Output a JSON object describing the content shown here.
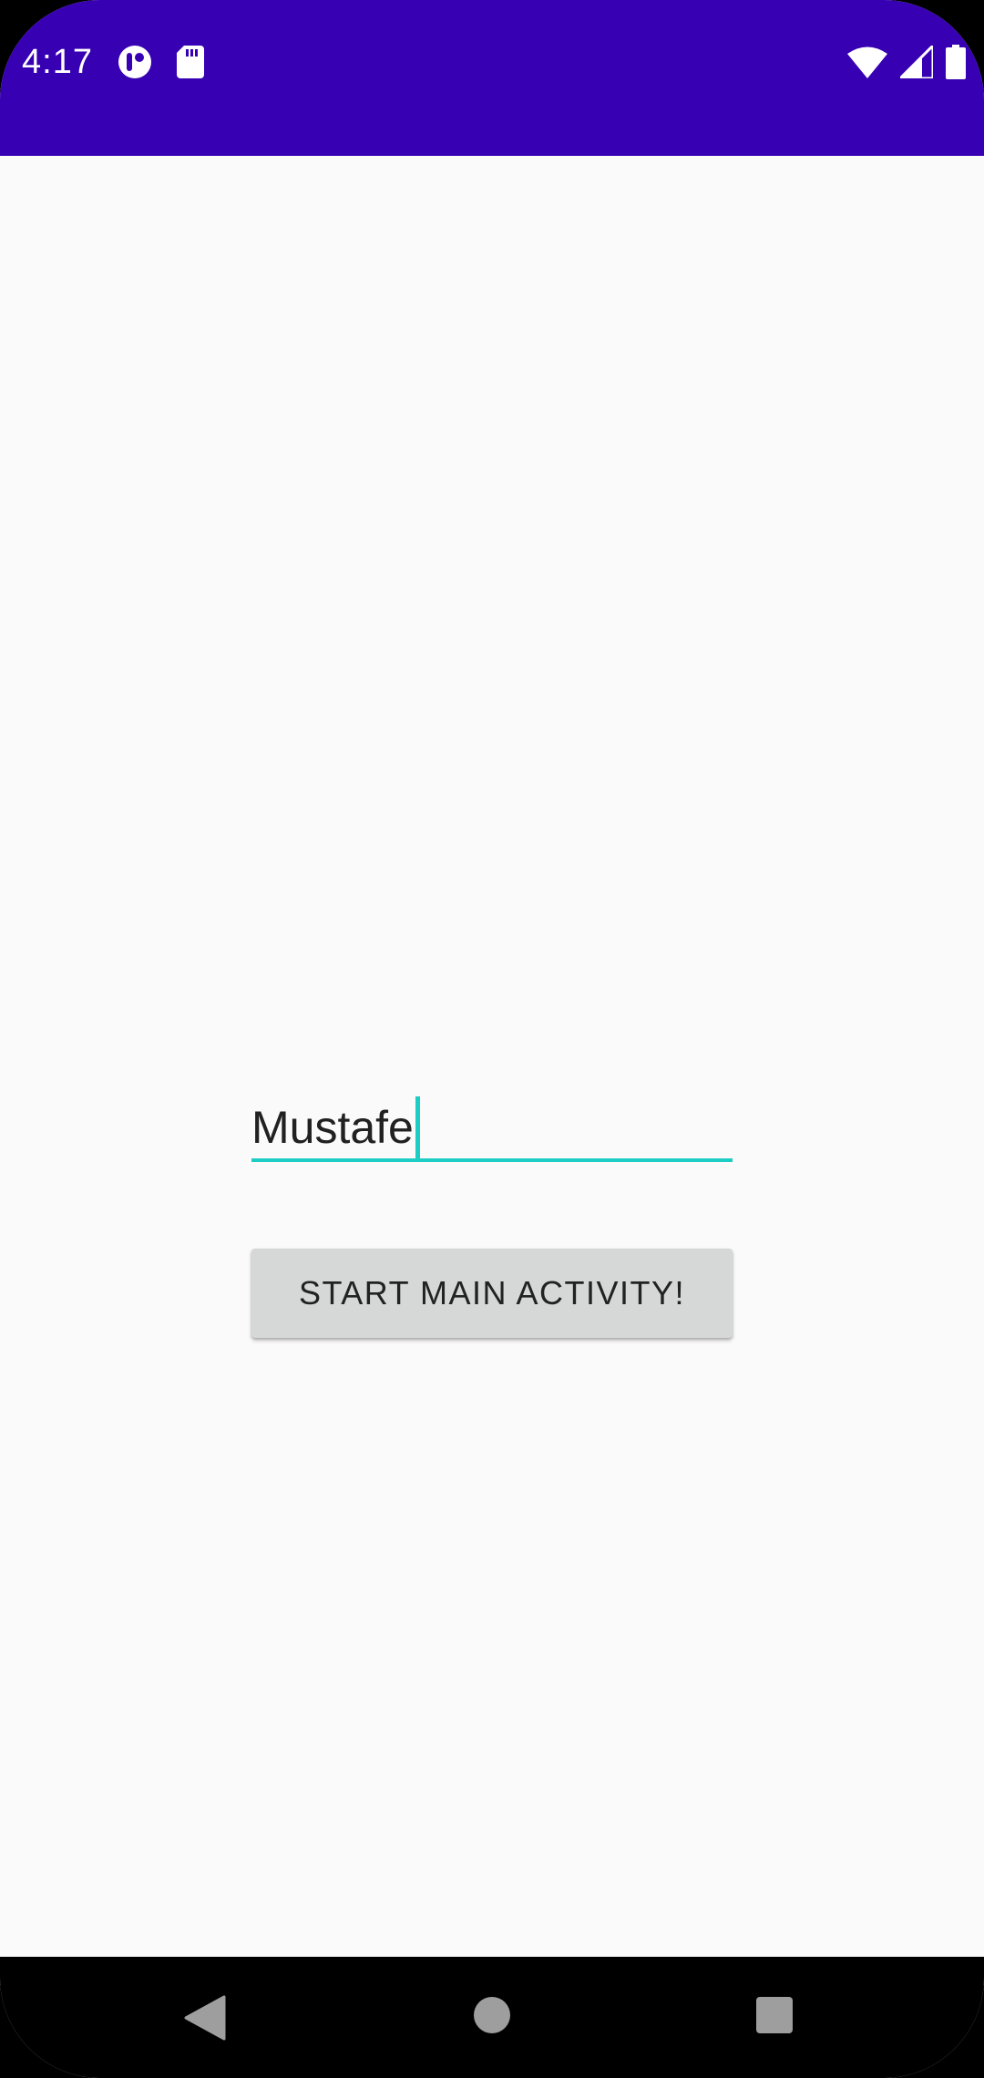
{
  "status_bar": {
    "time": "4:17",
    "left_icons": [
      "notification-app-icon",
      "sd-card-icon"
    ],
    "right_icons": [
      "wifi-icon",
      "cellular-signal-icon",
      "battery-icon"
    ],
    "background_color": "#3700b3"
  },
  "form": {
    "name_value": "Mustafe",
    "accent_color": "#1ccdc4"
  },
  "start_button": {
    "label": "START MAIN ACTIVITY!"
  },
  "nav_bar": {
    "buttons": [
      "back",
      "home",
      "recents"
    ]
  }
}
